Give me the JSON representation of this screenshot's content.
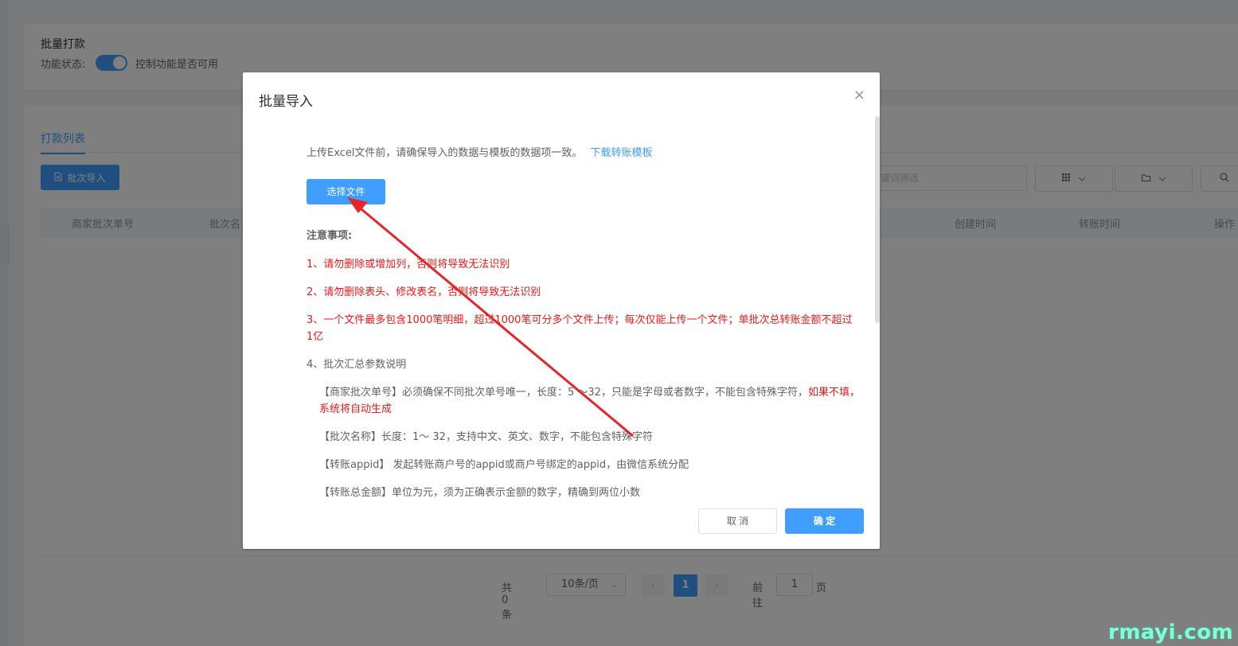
{
  "top_card": {
    "title": "批量打款",
    "status_label": "功能状态:",
    "switch_desc": "控制功能是否可用"
  },
  "list_card": {
    "tab": "打款列表",
    "import_button": "批次导入",
    "filter_placeholder": "键词筛选",
    "columns": [
      "商家批次单号",
      "批次名",
      "创建时间",
      "转账时间",
      "操作"
    ]
  },
  "pagination": {
    "total": "共 0 条",
    "page_size": "10条/页",
    "prev": "‹",
    "current_page": "1",
    "next": "›",
    "goto_label": "前往",
    "goto_value": "1",
    "page_unit": "页"
  },
  "dialog": {
    "title": "批量导入",
    "close": "×",
    "intro": "上传Excel文件前，请确保导入的数据与模板的数据项一致。",
    "download_link": "下载转账模板",
    "choose_file": "选择文件",
    "notes_title": "注意事项:",
    "note1": "1、请勿删除或增加列，否则将导致无法识别",
    "note2": "2、请勿删除表头、修改表名，否则将导致无法识别",
    "note3": "3、一个文件最多包含1000笔明细，超过1000笔可分多个文件上传；每次仅能上传一个文件；单批次总转账金额不超过1亿",
    "note4": "4、批次汇总参数说明",
    "param1_text": "【商家批次单号】必须确保不同批次单号唯一，长度：5 ～32，只能是字母或者数字，不能包含特殊字符，",
    "param1_red": "如果不填，系统将自动生成",
    "param2": "【批次名称】长度：1～ 32，支持中文、英文、数字，不能包含特殊字符",
    "param3": "【转账appid】 发起转账商户号的appid或商户号绑定的appid，由微信系统分配",
    "param4": "【转账总金额】单位为元，须为正确表示金额的数字，精确到两位小数",
    "cancel": "取 消",
    "ok": "确 定"
  },
  "watermark": "rmayi.com",
  "colors": {
    "primary": "#409eff",
    "warning_red": "#f01818",
    "annotation_arrow": "#e8242a"
  }
}
